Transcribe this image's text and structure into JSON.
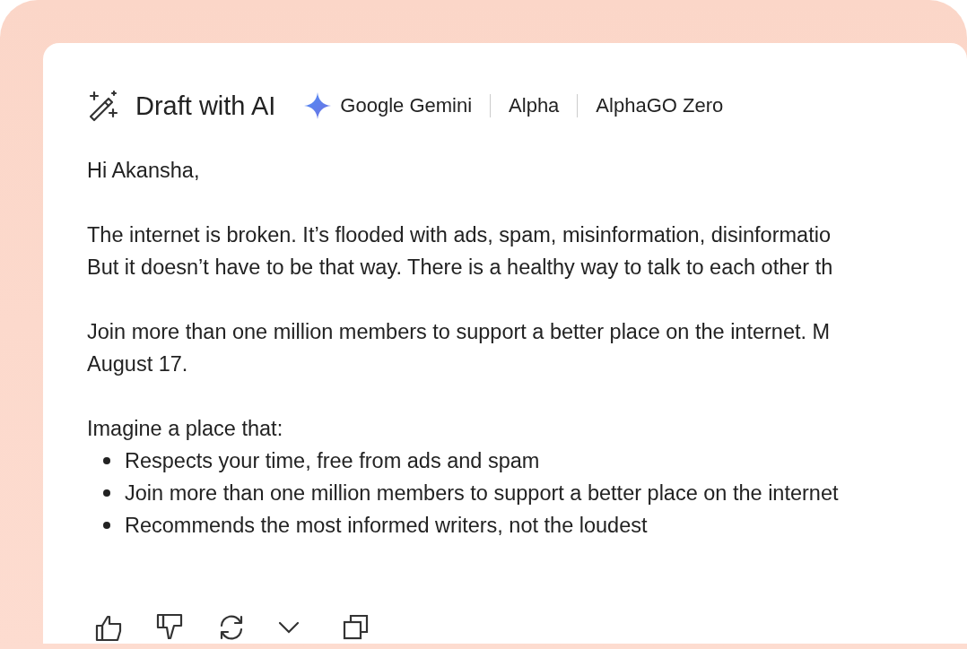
{
  "header": {
    "title": "Draft with AI",
    "models": [
      "Google Gemini",
      "Alpha",
      "AlphaGO Zero"
    ]
  },
  "draft": {
    "greeting": "Hi Akansha,",
    "paragraphs": [
      [
        "The internet is broken. It’s flooded with ads, spam, misinformation, disinformatio",
        "But it doesn’t have to be that way. There is a healthy way to talk to each other th"
      ],
      [
        "Join more than one million members to support a better place on the internet. M",
        "August 17."
      ],
      [
        "Imagine a place that:"
      ]
    ],
    "bullets": [
      "Respects your time, free from ads and spam",
      "Join more than one million members to support a better place on the internet",
      "Recommends the most informed writers, not the loudest"
    ]
  }
}
